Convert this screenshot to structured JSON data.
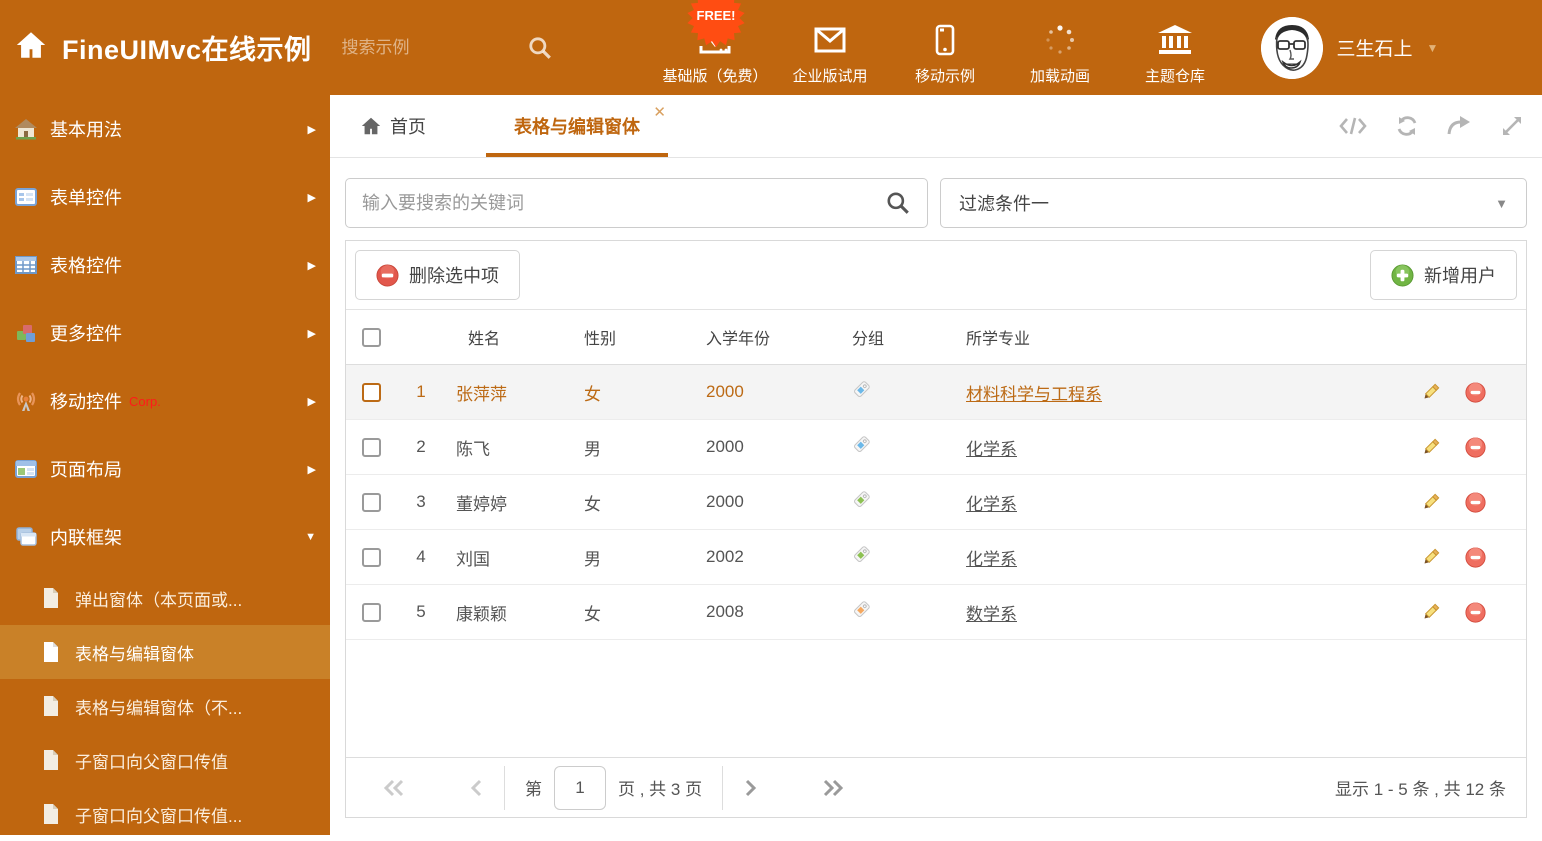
{
  "header": {
    "brand": "FineUIMvc在线示例",
    "search_placeholder": "搜索示例",
    "free_badge": "FREE!",
    "nav_items": [
      {
        "label": "基础版（免费）",
        "icon": "download-icon"
      },
      {
        "label": "企业版试用",
        "icon": "envelope-icon"
      },
      {
        "label": "移动示例",
        "icon": "mobile-icon"
      },
      {
        "label": "加载动画",
        "icon": "spinner-icon"
      },
      {
        "label": "主题仓库",
        "icon": "bank-icon"
      }
    ],
    "user": {
      "name": "三生石上"
    }
  },
  "sidebar": {
    "groups": [
      {
        "label": "基本用法"
      },
      {
        "label": "表单控件"
      },
      {
        "label": "表格控件"
      },
      {
        "label": "更多控件"
      },
      {
        "label": "移动控件",
        "badge": "Corp."
      },
      {
        "label": "页面布局"
      },
      {
        "label": "内联框架",
        "expanded": true
      }
    ],
    "subitems": [
      {
        "label": "弹出窗体（本页面或..."
      },
      {
        "label": "表格与编辑窗体",
        "active": true
      },
      {
        "label": "表格与编辑窗体（不..."
      },
      {
        "label": "子窗口向父窗口传值"
      },
      {
        "label": "子窗口向父窗口传值..."
      }
    ]
  },
  "tabs": {
    "home": {
      "label": "首页"
    },
    "active": {
      "label": "表格与编辑窗体",
      "close": "✕"
    }
  },
  "filters": {
    "search_placeholder": "输入要搜索的关键词",
    "filter_value": "过滤条件一"
  },
  "grid": {
    "delete_button": "删除选中项",
    "add_button": "新增用户",
    "columns": [
      "姓名",
      "性别",
      "入学年份",
      "分组",
      "所学专业"
    ],
    "rows": [
      {
        "num": "1",
        "name": "张萍萍",
        "gender": "女",
        "year": "2000",
        "tag_color": "#6cb8e8",
        "major": "材料科学与工程系",
        "selected": true
      },
      {
        "num": "2",
        "name": "陈飞",
        "gender": "男",
        "year": "2000",
        "tag_color": "#6cb8e8",
        "major": "化学系",
        "selected": false
      },
      {
        "num": "3",
        "name": "董婷婷",
        "gender": "女",
        "year": "2000",
        "tag_color": "#8dc153",
        "major": "化学系",
        "selected": false
      },
      {
        "num": "4",
        "name": "刘国",
        "gender": "男",
        "year": "2002",
        "tag_color": "#8dc153",
        "major": "化学系",
        "selected": false
      },
      {
        "num": "5",
        "name": "康颖颖",
        "gender": "女",
        "year": "2008",
        "tag_color": "#f5a85f",
        "major": "数学系",
        "selected": false
      }
    ]
  },
  "pagination": {
    "prefix": "第",
    "current_page": "1",
    "suffix": "页 , 共 3 页",
    "summary": "显示 1 - 5 条 , 共 12 条"
  },
  "colors": {
    "accent_orange": "#bf660f",
    "sidebar_active_bg": "#c98128",
    "selected_row_text": "#bc6a15",
    "free_badge_bg": "#ff4d12",
    "delete_red": "#e2574c",
    "add_green": "#71b544"
  }
}
